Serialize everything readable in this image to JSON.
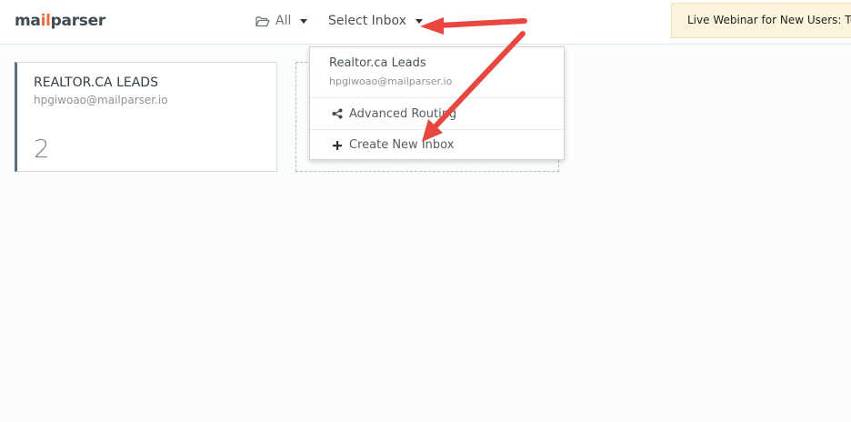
{
  "header": {
    "logo_prefix": "ma",
    "logo_accent": "il",
    "logo_suffix": "parser",
    "nav_all_label": "All",
    "nav_select_label": "Select Inbox",
    "banner_text": "Live Webinar for New Users: Tue"
  },
  "inbox_card": {
    "title": "REALTOR.CA LEADS",
    "email": "hpgiwoao@mailparser.io",
    "count": "2"
  },
  "dropdown": {
    "inbox_name": "Realtor.ca Leads",
    "inbox_email": "hpgiwoao@mailparser.io",
    "advanced_routing_label": "Advanced Routing",
    "create_new_inbox_label": "Create New Inbox"
  },
  "icons": {
    "folder": "folder-open-icon",
    "share": "share-icon",
    "plus": "plus-icon",
    "caret": "caret-down-icon"
  },
  "colors": {
    "brand_orange": "#f26b38",
    "annotation_red": "#e8473f",
    "banner_bg": "#fcf4dc"
  }
}
